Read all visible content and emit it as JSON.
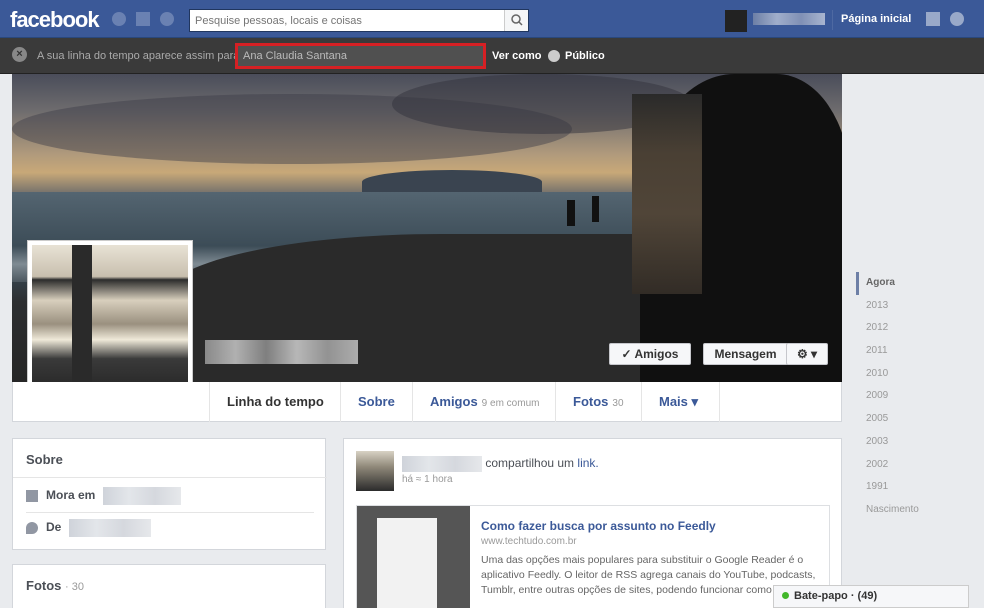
{
  "topbar": {
    "logo": "facebook",
    "search_placeholder": "Pesquise pessoas, locais e coisas",
    "home_label": "Página inicial"
  },
  "viewas": {
    "label": "A sua linha do tempo aparece assim para:",
    "field_value": "Ana Claudia Santana",
    "ver_como": "Ver como",
    "publico": "Público"
  },
  "cover": {
    "btn_amigos": "✓ Amigos",
    "btn_mensagem": "Mensagem",
    "btn_gear": "⚙ ▾"
  },
  "nav": {
    "items": [
      {
        "label": "Linha do tempo",
        "count": ""
      },
      {
        "label": "Sobre",
        "count": ""
      },
      {
        "label": "Amigos",
        "count": "9 em comum"
      },
      {
        "label": "Fotos",
        "count": "30"
      },
      {
        "label": "Mais ▾",
        "count": ""
      }
    ]
  },
  "sobre": {
    "title": "Sobre",
    "mora_em": "Mora em",
    "de": "De"
  },
  "fotos": {
    "title": "Fotos",
    "count": "· 30"
  },
  "post": {
    "action": "compartilhou um",
    "link_word": "link.",
    "time": "há ≈ 1 hora",
    "card_title": "Como fazer busca por assunto no Feedly",
    "card_url": "www.techtudo.com.br",
    "card_desc": "Uma das opções mais populares para substituir o Google Reader é o aplicativo Feedly. O leitor de RSS agrega canais do YouTube, podcasts, Tumblr, entre outras opções de sites, podendo funcionar como"
  },
  "timeline_years": [
    "Agora",
    "2013",
    "2012",
    "2011",
    "2010",
    "2009",
    "2005",
    "2003",
    "2002",
    "1991",
    "Nascimento"
  ],
  "chat": {
    "label": "Bate-papo · (49)"
  }
}
